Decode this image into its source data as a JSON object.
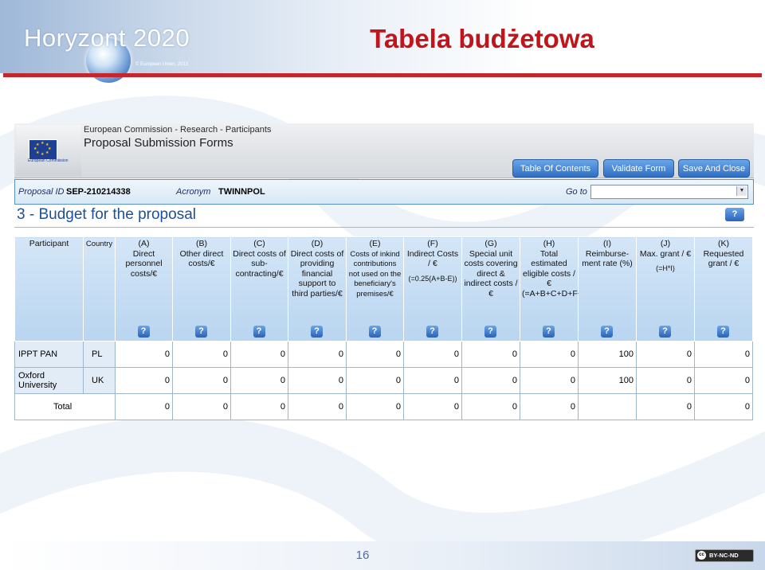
{
  "slide": {
    "logo_text": "Horyzont 2020",
    "logo_copyright": "© European Union, 2013",
    "title": "Tabela budżetowa",
    "page_number": "16",
    "license_badge": "BY-NC-ND",
    "license_cc": "cc",
    "colors": {
      "title": "#c0151b",
      "rule": "#c3272d",
      "accent": "#2f6fc4"
    }
  },
  "portal": {
    "breadcrumb": "European Commission - Research - Participants",
    "app_title": "Proposal Submission Forms",
    "ec_logo_text": "European Commission",
    "buttons": {
      "table_of_contents": "Table Of Contents",
      "validate_form": "Validate Form",
      "save_and_close": "Save And Close"
    },
    "proposal_id_label": "Proposal ID",
    "proposal_id": "SEP-210214338",
    "acronym_label": "Acronym",
    "acronym": "TWINNPOL",
    "goto_label": "Go to",
    "goto_value": "",
    "section_title": "3 - Budget for the proposal",
    "help_icon": "question-icon",
    "help_glyph": "?"
  },
  "budget_table": {
    "participant_header": "Participant",
    "country_header": "Country",
    "columns": [
      {
        "code": "(A)",
        "label": "Direct personnel costs/€",
        "formula": ""
      },
      {
        "code": "(B)",
        "label": "Other direct costs/€",
        "formula": ""
      },
      {
        "code": "(C)",
        "label": "Direct costs of sub-contracting/€",
        "formula": ""
      },
      {
        "code": "(D)",
        "label": "Direct costs of providing financial support to third parties/€",
        "formula": ""
      },
      {
        "code": "(E)",
        "label": "Costs of inkind contributions not used on the beneficiary's premises/€",
        "formula": ""
      },
      {
        "code": "(F)",
        "label": "Indirect Costs / €",
        "formula": "(=0.25(A+B-E))"
      },
      {
        "code": "(G)",
        "label": "Special unit costs covering direct & indirect costs / €",
        "formula": ""
      },
      {
        "code": "(H)",
        "label": "Total estimated eligible costs / € (=A+B+C+D+F+G)",
        "formula": ""
      },
      {
        "code": "(I)",
        "label": "Reimburse-ment rate (%)",
        "formula": ""
      },
      {
        "code": "(J)",
        "label": "Max. grant / €",
        "formula": "(=H*I)"
      },
      {
        "code": "(K)",
        "label": "Requested grant / €",
        "formula": ""
      }
    ],
    "rows": [
      {
        "participant": "IPPT PAN",
        "country": "PL",
        "values": [
          "0",
          "0",
          "0",
          "0",
          "0",
          "0",
          "0",
          "0",
          "100",
          "0",
          "0"
        ]
      },
      {
        "participant": "Oxford University",
        "country": "UK",
        "values": [
          "0",
          "0",
          "0",
          "0",
          "0",
          "0",
          "0",
          "0",
          "100",
          "0",
          "0"
        ]
      }
    ],
    "total": {
      "label": "Total",
      "values": [
        "0",
        "0",
        "0",
        "0",
        "0",
        "0",
        "0",
        "0",
        "",
        "0",
        "0"
      ]
    }
  }
}
